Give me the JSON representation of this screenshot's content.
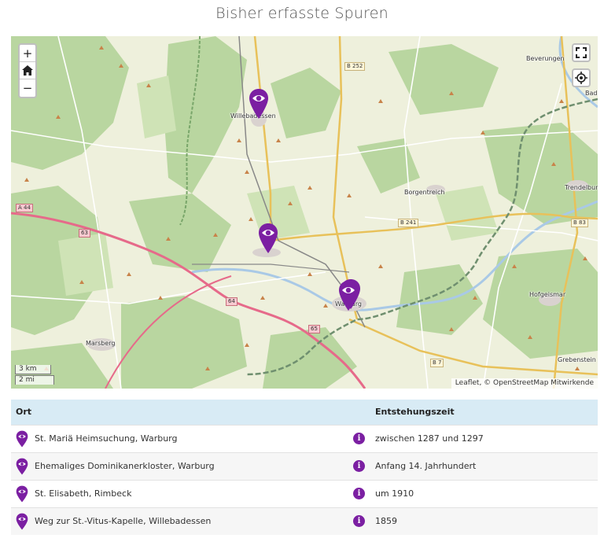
{
  "page": {
    "title": "Bisher erfasste Spuren"
  },
  "map": {
    "controls": {
      "zoom_in": "+",
      "zoom_out": "−"
    },
    "scale": {
      "metric": "3 km",
      "imperial": "2 mi"
    },
    "attribution": "Leaflet, © OpenStreetMap Mitwirkende",
    "places": [
      {
        "name": "Willebadessen"
      },
      {
        "name": "Beverungen"
      },
      {
        "name": "Bad"
      },
      {
        "name": "Borgentreich"
      },
      {
        "name": "Trendelburg"
      },
      {
        "name": "Hofgeismar"
      },
      {
        "name": "Warburg"
      },
      {
        "name": "Marsberg"
      },
      {
        "name": "Grebenstein"
      }
    ],
    "roads": [
      {
        "label": "B 252"
      },
      {
        "label": "A 44"
      },
      {
        "label": "B 241"
      },
      {
        "label": "B 83"
      },
      {
        "label": "B 7"
      },
      {
        "label": "63"
      },
      {
        "label": "64"
      },
      {
        "label": "65"
      }
    ],
    "colors": {
      "marker": "#7b1fa2",
      "route": "#e66a8a",
      "border": "#6f8f6f",
      "river": "#a9c9e6"
    }
  },
  "table": {
    "headers": {
      "ort": "Ort",
      "zeit": "Entstehungszeit"
    },
    "rows": [
      {
        "ort": "St. Mariä Heimsuchung, Warburg",
        "zeit": "zwischen 1287 und 1297"
      },
      {
        "ort": "Ehemaliges Dominikanerkloster, Warburg",
        "zeit": "Anfang 14. Jahrhundert"
      },
      {
        "ort": "St. Elisabeth, Rimbeck",
        "zeit": "um 1910"
      },
      {
        "ort": "Weg zur St.-Vitus-Kapelle, Willebadessen",
        "zeit": "1859"
      }
    ],
    "info_glyph": "i"
  }
}
